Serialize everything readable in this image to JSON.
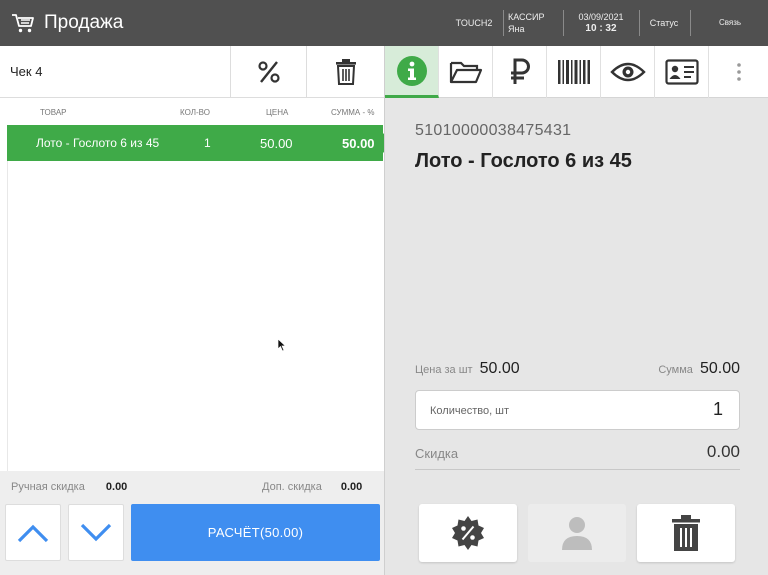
{
  "header": {
    "title": "Продажа",
    "terminal": "TOUCH2",
    "cashier_label": "КАССИР",
    "cashier_name": "Яна",
    "date": "03/09/2021",
    "time": "10 : 32",
    "status": "Статус",
    "link": "Связь"
  },
  "receipt": {
    "label": "Чек 4",
    "columns": {
      "item": "ТОВАР",
      "qty": "КОЛ-ВО",
      "price": "ЦЕНА",
      "sum": "СУММА - %"
    },
    "rows": [
      {
        "name": "Лото - Гослото 6 из 45",
        "qty": "1",
        "price": "50.00",
        "sum": "50.00"
      }
    ],
    "manual_discount_label": "Ручная скидка",
    "manual_discount_value": "0.00",
    "extra_discount_label": "Доп. скидка",
    "extra_discount_value": "0.00",
    "pay_button": "РАСЧЁТ(50.00)"
  },
  "details": {
    "code": "51010000038475431",
    "name": "Лото - Гослото 6 из 45",
    "price_label": "Цена за шт",
    "price_value": "50.00",
    "sum_label": "Сумма",
    "sum_value": "50.00",
    "qty_label": "Количество, шт",
    "qty_value": "1",
    "discount_label": "Скидка",
    "discount_value": "0.00"
  },
  "colors": {
    "header_bg": "#505050",
    "accent_green": "#3faa48",
    "pay_blue": "#3f8ef0",
    "nav_arrow_blue": "#3f8ef0"
  },
  "icons": [
    "cart-icon",
    "percent-icon",
    "trash-icon",
    "info-icon",
    "folder-open-icon",
    "ruble-icon",
    "barcode-icon",
    "eye-icon",
    "id-card-icon",
    "more-vert-icon",
    "chevron-up-icon",
    "chevron-down-icon",
    "discount-badge-icon",
    "person-icon"
  ]
}
